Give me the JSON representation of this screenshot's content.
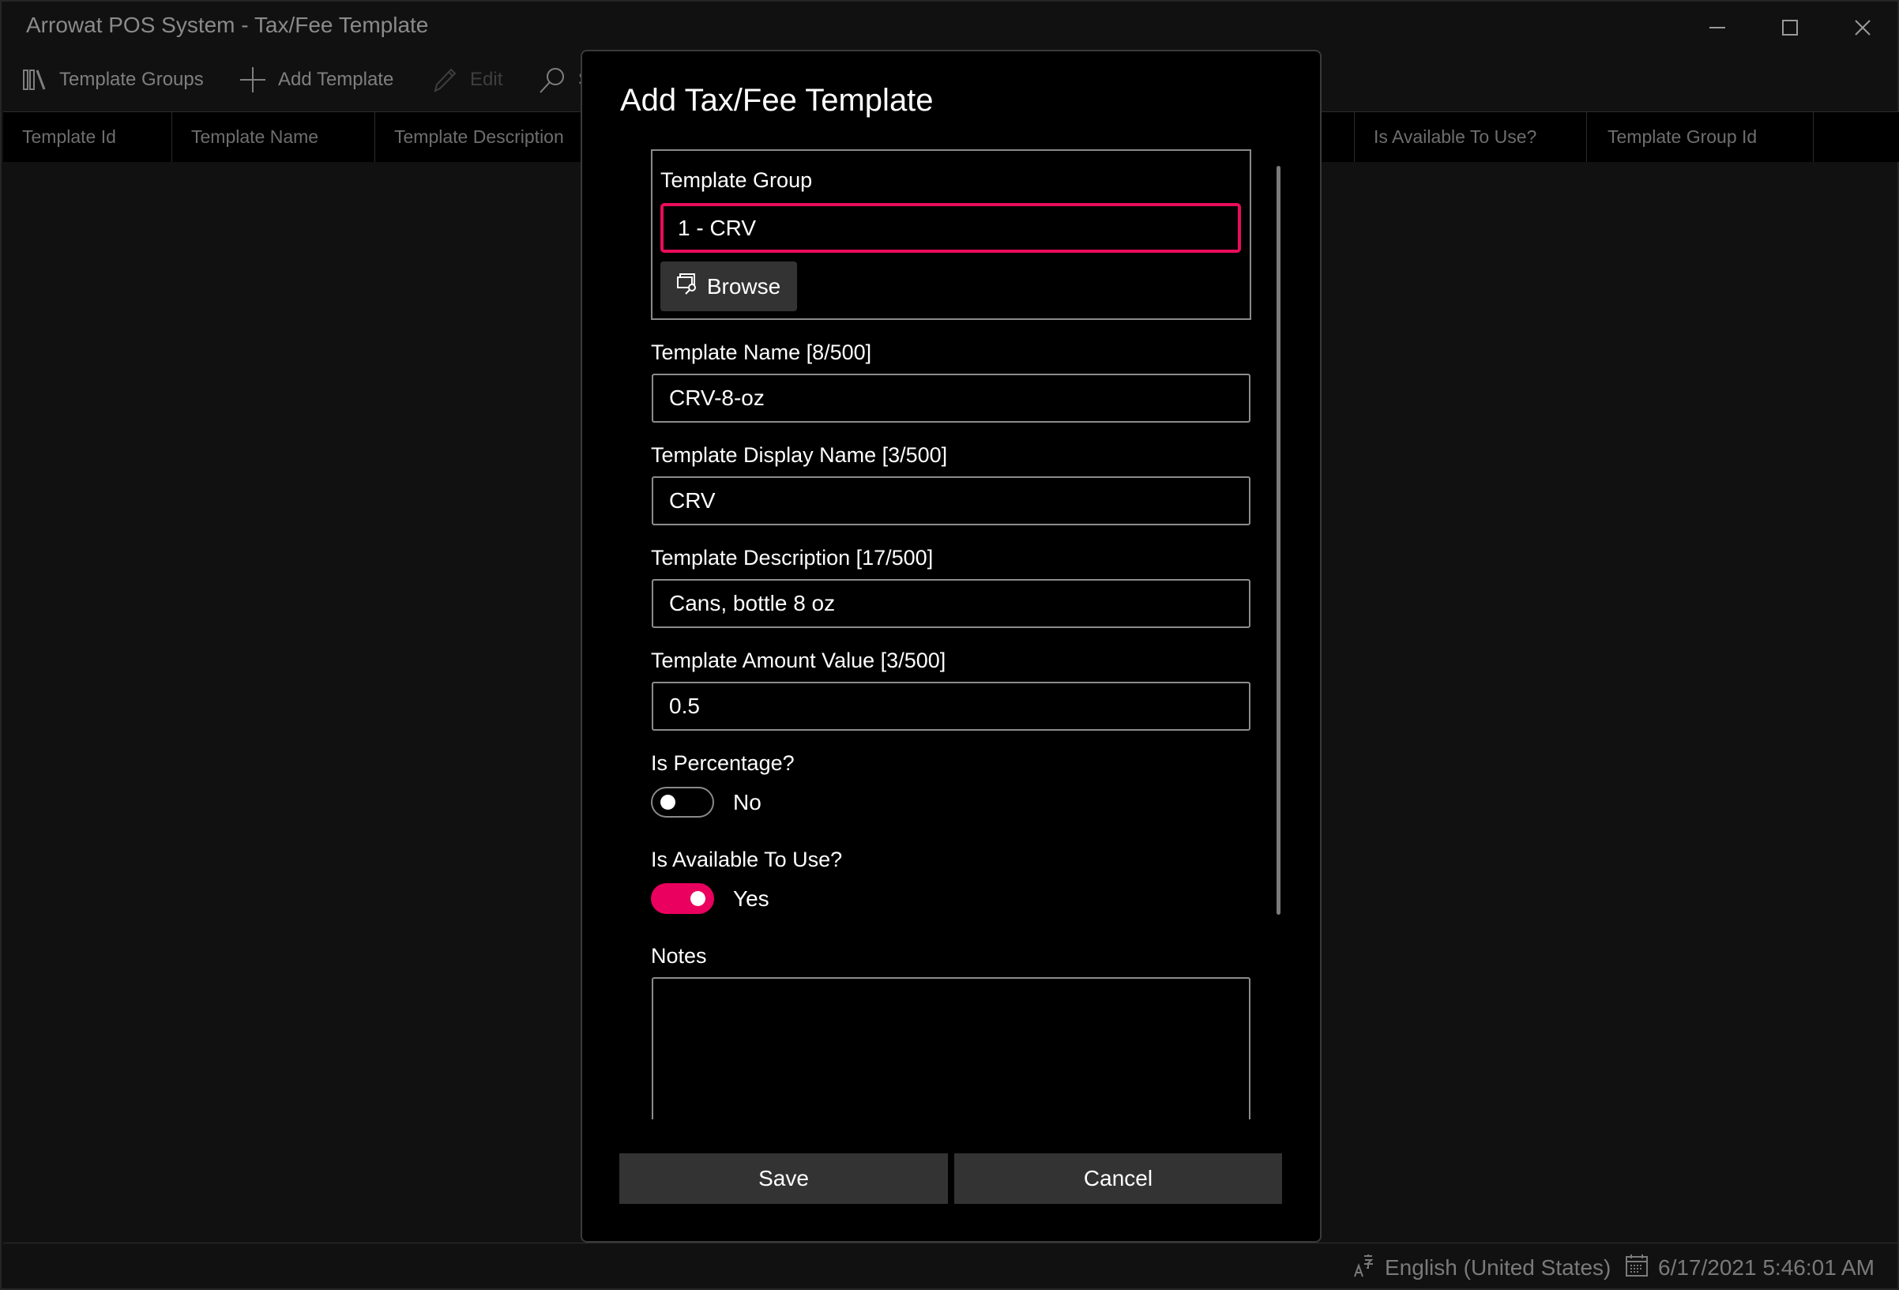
{
  "window": {
    "title": "Arrowat POS System - Tax/Fee Template",
    "controls": {
      "minimize": "minimize-icon",
      "maximize": "maximize-icon",
      "close": "close-icon"
    }
  },
  "toolbar": {
    "items": [
      {
        "label": "Template Groups",
        "icon": "library-icon",
        "enabled": true
      },
      {
        "label": "Add Template",
        "icon": "plus-icon",
        "enabled": true
      },
      {
        "label": "Edit",
        "icon": "pencil-icon",
        "enabled": false
      },
      {
        "label": "S",
        "icon": "search-icon",
        "enabled": true
      }
    ]
  },
  "grid": {
    "columns": [
      "Template Id",
      "Template Name",
      "Template Description",
      "Is Available To Use?",
      "Template Group Id"
    ],
    "rows": []
  },
  "dialog": {
    "title": "Add Tax/Fee Template",
    "template_group": {
      "label": "Template Group",
      "value": "1 - CRV",
      "browse_label": "Browse",
      "browse_icon": "browse-search-icon"
    },
    "fields": [
      {
        "label": "Template Name [8/500]",
        "value": "CRV-8-oz"
      },
      {
        "label": "Template Display Name [3/500]",
        "value": "CRV"
      },
      {
        "label": "Template Description [17/500]",
        "value": "Cans, bottle 8 oz"
      },
      {
        "label": "Template Amount Value [3/500]",
        "value": "0.5"
      }
    ],
    "is_percentage": {
      "label": "Is Percentage?",
      "on": false,
      "state_text": "No"
    },
    "is_available": {
      "label": "Is Available To Use?",
      "on": true,
      "state_text": "Yes"
    },
    "notes": {
      "label": "Notes",
      "value": ""
    },
    "save_label": "Save",
    "cancel_label": "Cancel"
  },
  "status_bar": {
    "language": "English (United States)",
    "datetime": "6/17/2021 5:46:01 AM"
  },
  "colors": {
    "accent": "#EA005E",
    "dialog_bg": "#000000",
    "window_bg": "#111111",
    "button_bg": "#333333"
  }
}
